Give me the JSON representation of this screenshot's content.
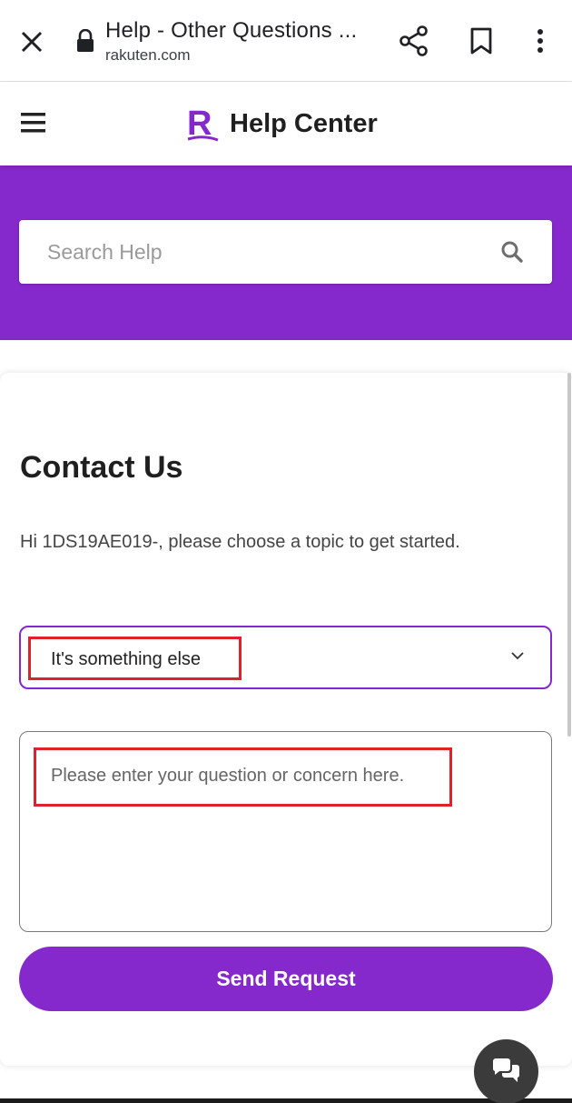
{
  "browser": {
    "page_title": "Help - Other Questions ...",
    "domain": "rakuten.com",
    "icons": [
      "close-icon",
      "lock-icon",
      "share-icon",
      "bookmark-icon",
      "more-vert-icon"
    ]
  },
  "header": {
    "brand_letter": "R",
    "title": "Help Center",
    "icons": [
      "hamburger-icon",
      "rakuten-logo"
    ]
  },
  "search": {
    "placeholder": "Search Help",
    "icon": "search-icon"
  },
  "contact": {
    "title": "Contact Us",
    "greeting": "Hi 1DS19AE019-, please choose a topic to get started.",
    "topic_selected": "It's something else",
    "question_placeholder": "Please enter your question or concern here.",
    "send_label": "Send Request"
  },
  "chat": {
    "icon": "chat-bubbles-icon"
  },
  "colors": {
    "brand_purple": "#8529cd",
    "highlight_red": "#e0202a",
    "fab_dark": "#3b3b3b"
  }
}
